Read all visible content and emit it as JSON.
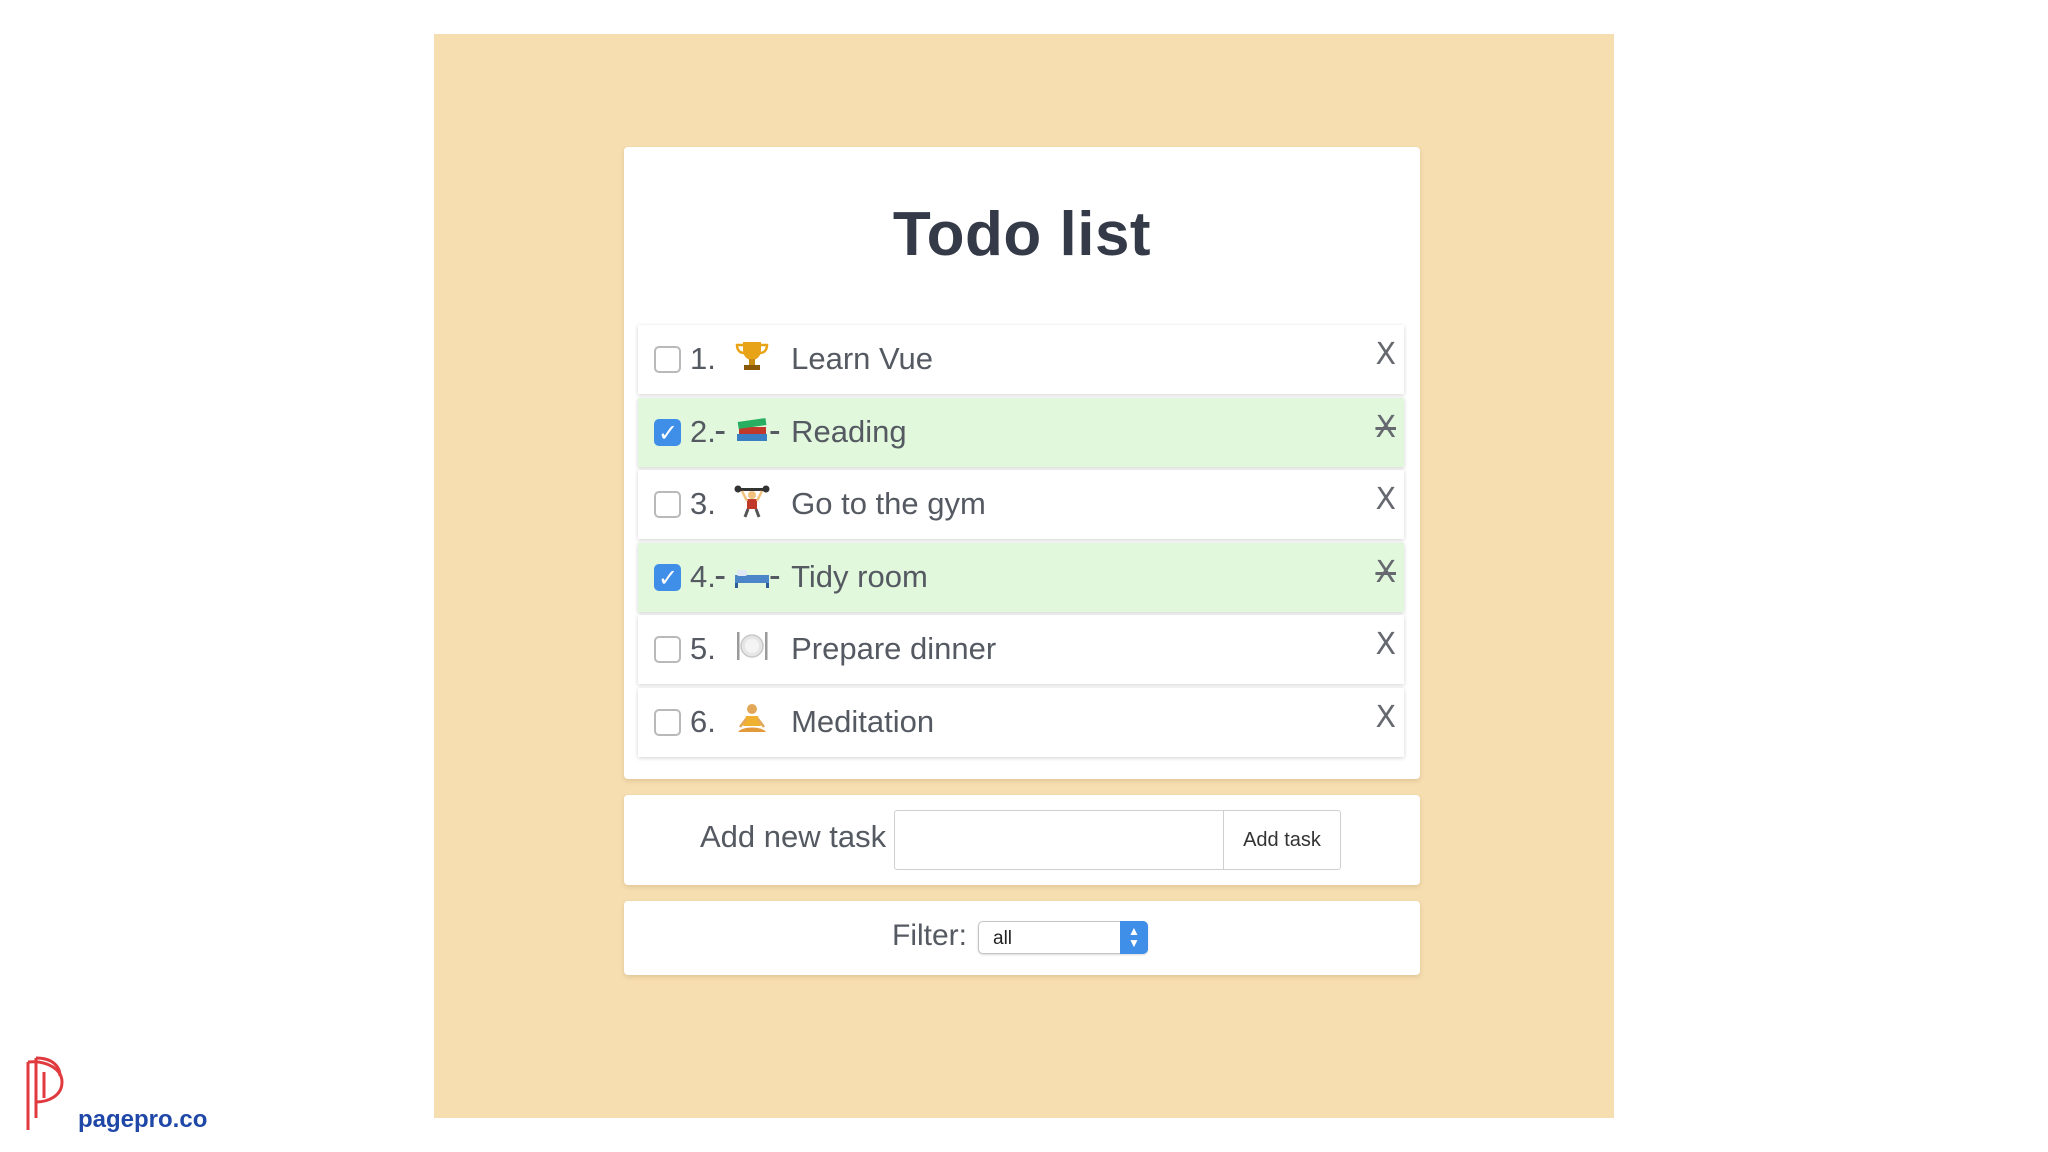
{
  "title": "Todo list",
  "tasks": [
    {
      "number": "1.",
      "icon": "trophy-icon",
      "label": "Learn Vue",
      "done": false
    },
    {
      "number": "2.",
      "icon": "books-icon",
      "label": "Reading",
      "done": true
    },
    {
      "number": "3.",
      "icon": "weightlifter-icon",
      "label": "Go to the gym",
      "done": false
    },
    {
      "number": "4.",
      "icon": "bed-icon",
      "label": "Tidy room",
      "done": true
    },
    {
      "number": "5.",
      "icon": "plate-icon",
      "label": "Prepare dinner",
      "done": false
    },
    {
      "number": "6.",
      "icon": "meditation-icon",
      "label": "Meditation",
      "done": false
    }
  ],
  "delete_label": "X",
  "add_task": {
    "label": "Add new task",
    "value": "",
    "button_label": "Add task"
  },
  "filter": {
    "label": "Filter:",
    "selected": "all"
  },
  "brand": {
    "name": "pagepro.co"
  },
  "colors": {
    "panel_background": "#f6deb1",
    "done_row": "#e1f8dc",
    "checkbox_checked": "#3f8ee8",
    "brand_red": "#e03a3e",
    "brand_blue": "#1f47a8"
  }
}
